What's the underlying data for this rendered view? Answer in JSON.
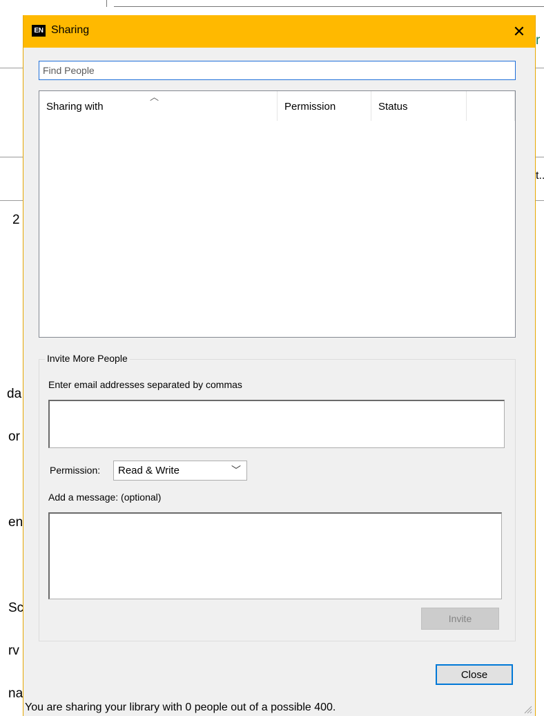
{
  "background": {
    "fragments": [
      "r",
      "t..",
      "2",
      "da",
      "or",
      "en",
      "Sc",
      "rv",
      "na"
    ]
  },
  "dialog": {
    "title": "Sharing",
    "app_icon_text": "EN",
    "close_glyph": "✕",
    "accent_color": "#ffb900",
    "find": {
      "placeholder": "Find People",
      "value": ""
    },
    "list": {
      "columns": [
        "Sharing with",
        "Permission",
        "Status",
        ""
      ],
      "rows": []
    },
    "invite": {
      "group_label": "Invite More People",
      "email_label": "Enter email addresses separated by commas",
      "email_value": "",
      "permission_label": "Permission:",
      "permission_selected": "Read & Write",
      "message_label": "Add a message: (optional)",
      "message_value": "",
      "invite_button": "Invite"
    },
    "close_button": "Close",
    "status_text": "You are sharing your library with 0 people out of a possible 400."
  }
}
